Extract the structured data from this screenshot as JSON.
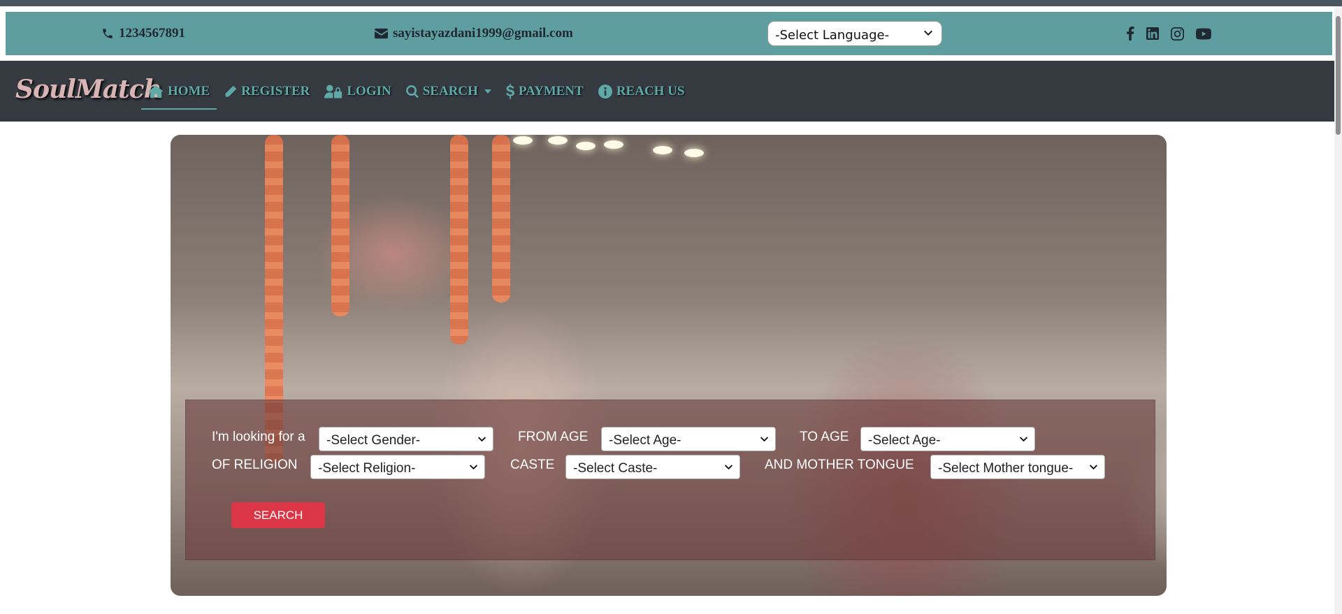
{
  "contact": {
    "phone": "1234567891",
    "email": "sayistayazdani1999@gmail.com",
    "language_select": "-Select Language-",
    "socials": [
      "facebook-icon",
      "linkedin-icon",
      "instagram-icon",
      "youtube-icon"
    ]
  },
  "navbar": {
    "brand": "SoulMatch",
    "items": [
      {
        "label": "HOME",
        "icon": "home-icon",
        "active": true
      },
      {
        "label": "REGISTER",
        "icon": "pencil-icon"
      },
      {
        "label": "LOGIN",
        "icon": "user-lock-icon"
      },
      {
        "label": "SEARCH",
        "icon": "search-icon",
        "dropdown": true
      },
      {
        "label": "PAYMENT",
        "icon": "dollar-icon"
      },
      {
        "label": "REACH US",
        "icon": "info-circle-icon"
      }
    ]
  },
  "search_form": {
    "looking_for_label": "I'm looking for a",
    "gender_select": "-Select Gender-",
    "from_age_label": "FROM AGE",
    "from_age_select": "-Select Age-",
    "to_age_label": "TO AGE",
    "to_age_select": "-Select Age-",
    "religion_label": "OF RELIGION",
    "religion_select": "-Select Religion-",
    "caste_label": "CASTE",
    "caste_select": "-Select Caste-",
    "mother_tongue_label": "AND MOTHER TONGUE",
    "mother_tongue_select": "-Select Mother tongue-",
    "search_button": "SEARCH"
  },
  "colors": {
    "contact_bar": "#5f9ea0",
    "navbar": "#343a40",
    "nav_text": "#5fa8a8",
    "brand": "#d9b4b4",
    "search_button": "#dc3545"
  }
}
